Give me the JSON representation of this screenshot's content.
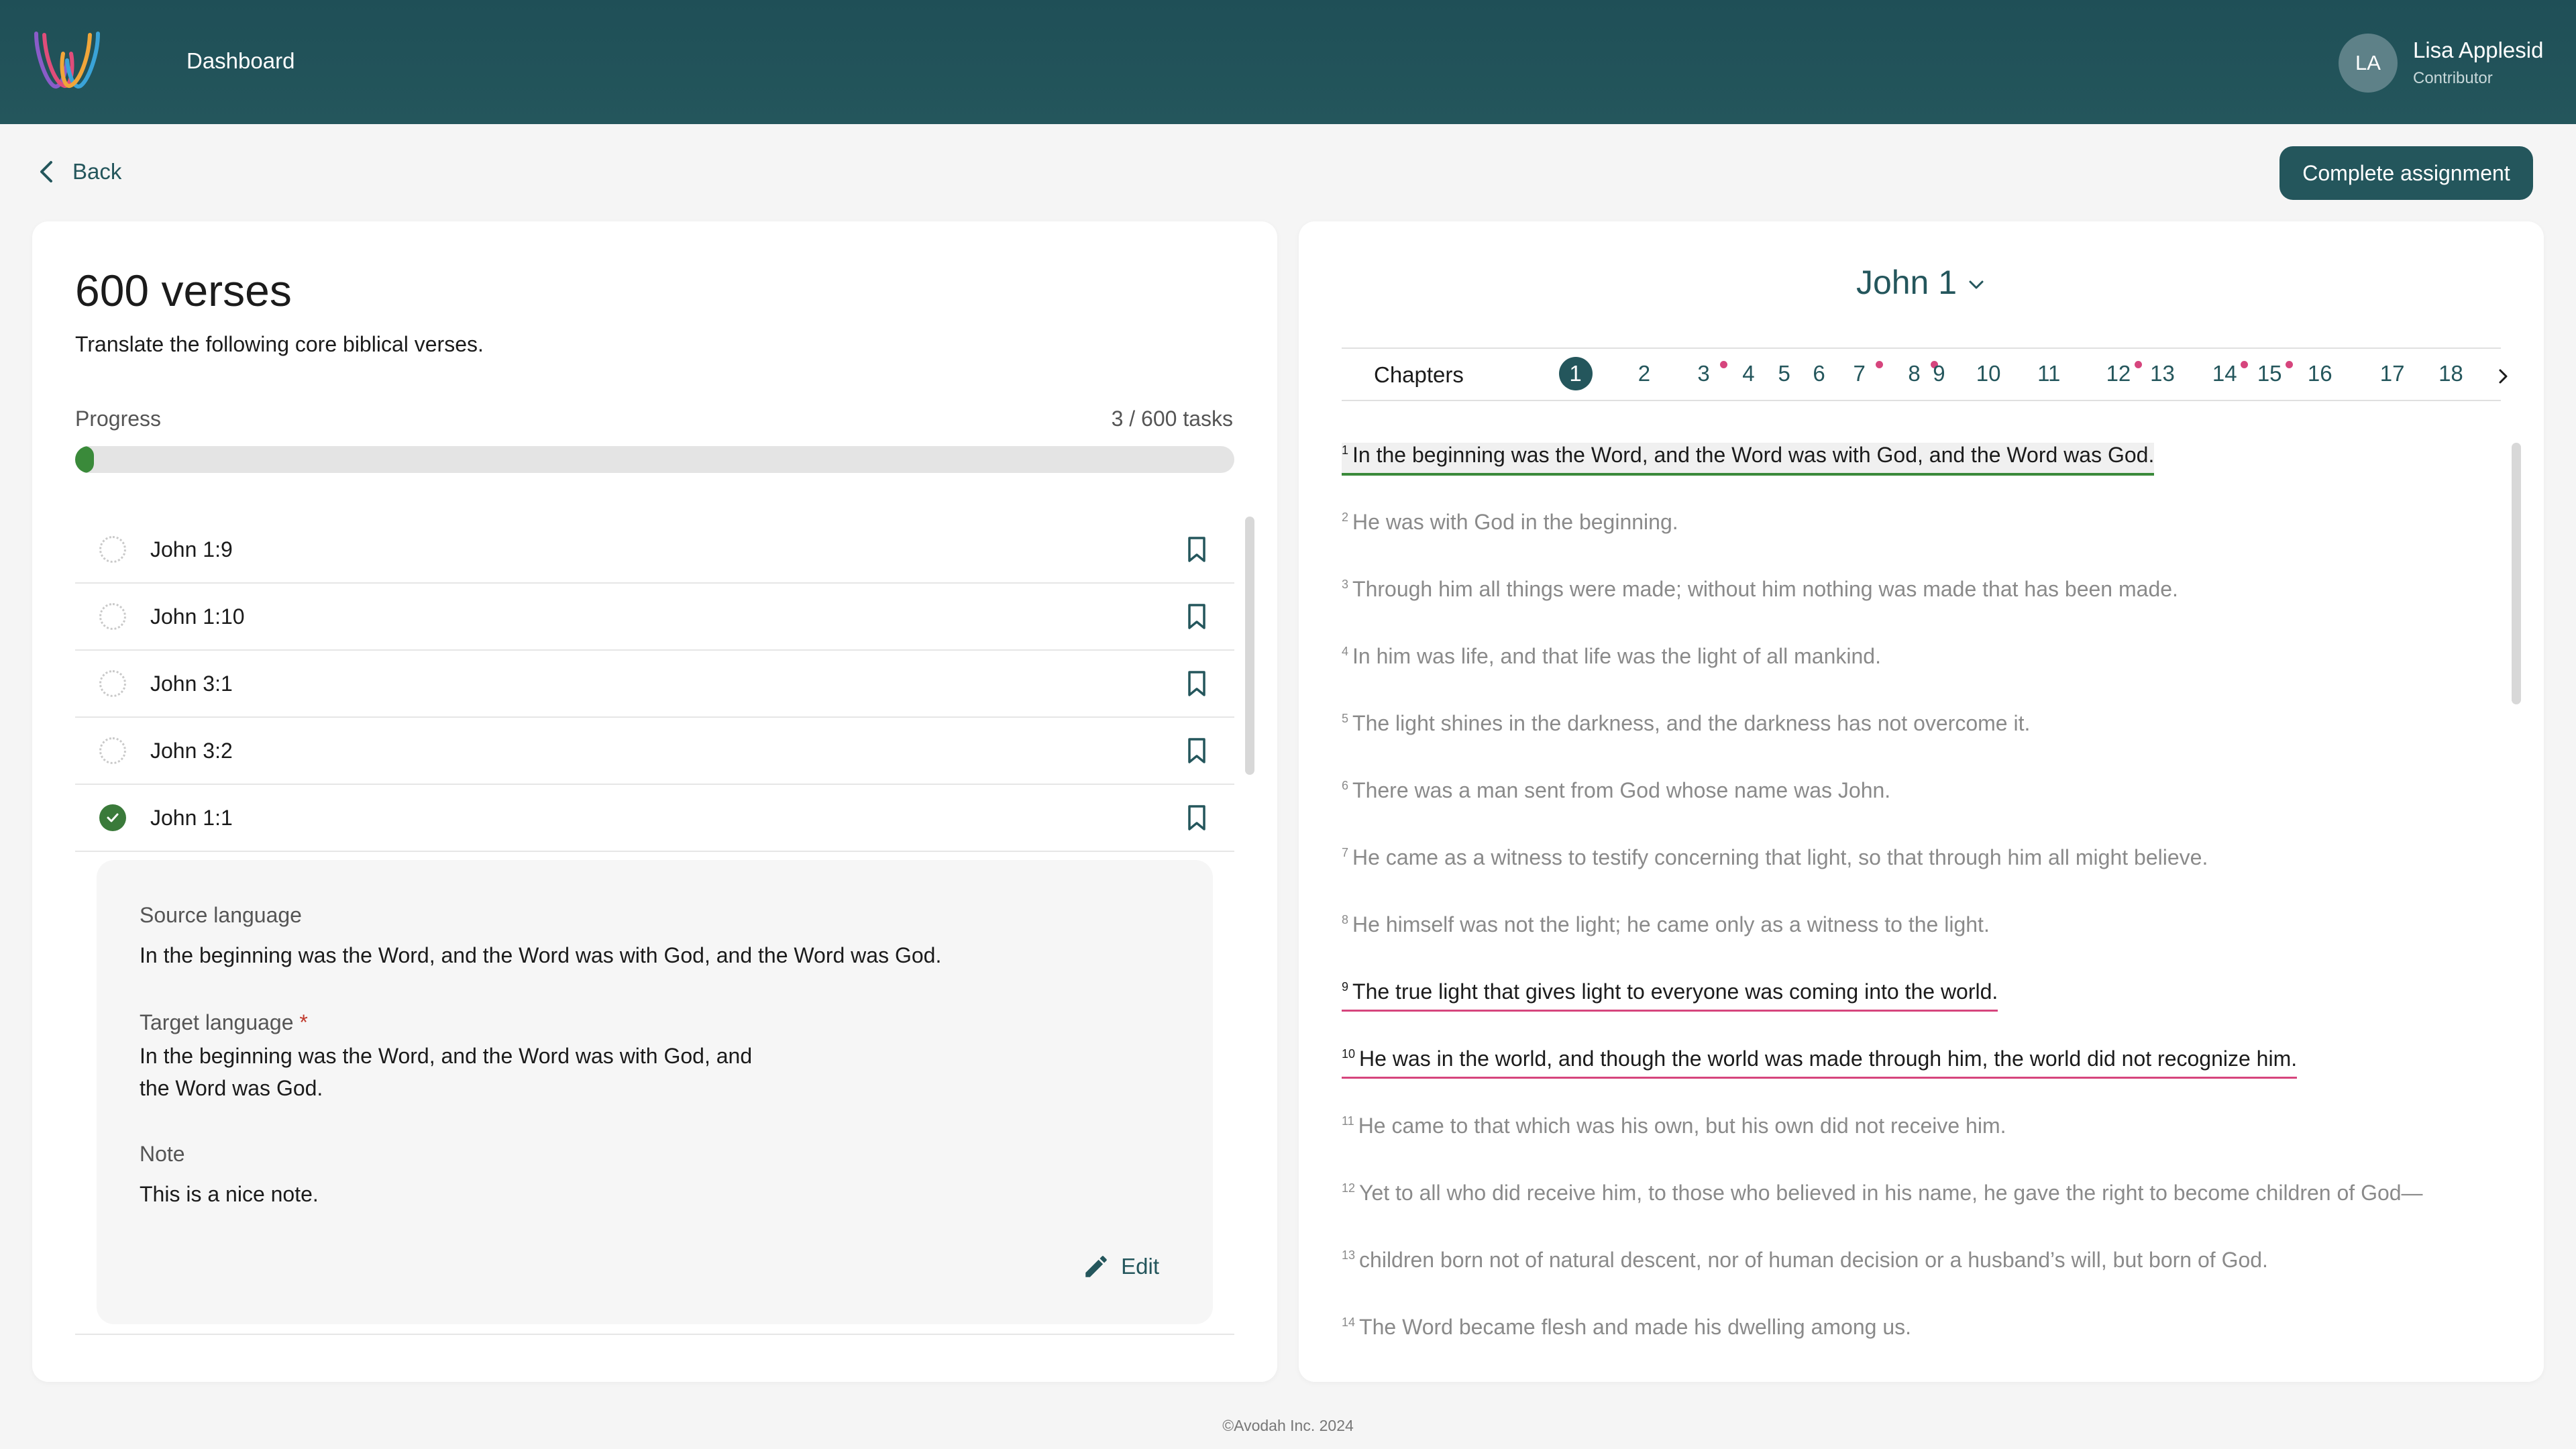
{
  "header": {
    "nav_label": "Dashboard",
    "user": {
      "initials": "LA",
      "name": "Lisa Applesid",
      "role": "Contributor"
    }
  },
  "toolbar": {
    "back_label": "Back",
    "complete_label": "Complete assignment"
  },
  "task": {
    "title": "600 verses",
    "subtitle": "Translate the following core biblical verses.",
    "progress_label": "Progress",
    "progress_text": "3 / 600 tasks",
    "progress_fraction": 0.005
  },
  "verse_list": [
    {
      "ref": "John 1:9",
      "done": false
    },
    {
      "ref": "John 1:10",
      "done": false
    },
    {
      "ref": "John 3:1",
      "done": false
    },
    {
      "ref": "John 3:2",
      "done": false
    },
    {
      "ref": "John 1:1",
      "done": true
    }
  ],
  "detail": {
    "source_label": "Source language",
    "source_text": "In the beginning was the Word, and the Word was with God, and the Word was God.",
    "target_label": "Target language",
    "required_mark": "*",
    "target_line1": "In the beginning was the Word, and the Word was with God, and",
    "target_line2": "the Word was God.",
    "note_label": "Note",
    "note_text": "This is a nice note.",
    "edit_label": "Edit"
  },
  "reader": {
    "book_label": "John 1",
    "chapters_label": "Chapters",
    "chapters": [
      {
        "n": "1",
        "active": true,
        "dot": false
      },
      {
        "n": "2",
        "active": false,
        "dot": false
      },
      {
        "n": "3",
        "active": false,
        "dot": true
      },
      {
        "n": "4",
        "active": false,
        "dot": false
      },
      {
        "n": "5",
        "active": false,
        "dot": false
      },
      {
        "n": "6",
        "active": false,
        "dot": false
      },
      {
        "n": "7",
        "active": false,
        "dot": true
      },
      {
        "n": "8",
        "active": false,
        "dot": true
      },
      {
        "n": "9",
        "active": false,
        "dot": false
      },
      {
        "n": "10",
        "active": false,
        "dot": false
      },
      {
        "n": "11",
        "active": false,
        "dot": false
      },
      {
        "n": "12",
        "active": false,
        "dot": true
      },
      {
        "n": "13",
        "active": false,
        "dot": false
      },
      {
        "n": "14",
        "active": false,
        "dot": true
      },
      {
        "n": "15",
        "active": false,
        "dot": true
      },
      {
        "n": "16",
        "active": false,
        "dot": false
      },
      {
        "n": "17",
        "active": false,
        "dot": false
      },
      {
        "n": "18",
        "active": false,
        "dot": false
      }
    ],
    "verses": [
      {
        "num": "1",
        "text": "In the beginning was the Word, and the Word was with God, and the Word was God.",
        "state": "current"
      },
      {
        "num": "2",
        "text": "He was with God in the beginning.",
        "state": "normal"
      },
      {
        "num": "3",
        "text": "Through him all things were made; without him nothing was made that has been made.",
        "state": "normal"
      },
      {
        "num": "4",
        "text": "In him was life, and that life was the light of all mankind.",
        "state": "normal"
      },
      {
        "num": "5",
        "text": "The light shines in the darkness, and the darkness has not overcome it.",
        "state": "normal"
      },
      {
        "num": "6",
        "text": "There was a man sent from God whose name was John.",
        "state": "normal"
      },
      {
        "num": "7",
        "text": "He came as a witness to testify concerning that light, so that through him all might believe.",
        "state": "normal"
      },
      {
        "num": "8",
        "text": "He himself was not the light; he came only as a witness to the light.",
        "state": "normal"
      },
      {
        "num": "9",
        "text": "The true light that gives light to everyone was coming into the world.",
        "state": "flagged"
      },
      {
        "num": "10",
        "text": "He was in the world, and though the world was made through him, the world did not recognize him.",
        "state": "flagged"
      },
      {
        "num": "11",
        "text": "He came to that which was his own, but his own did not receive him.",
        "state": "normal"
      },
      {
        "num": "12",
        "text": "Yet to all who did receive him, to those who believed in his name, he gave the right to become children of God—",
        "state": "normal"
      },
      {
        "num": "13",
        "text": "children born not of natural descent, nor of human decision or a husband’s will, but born of God.",
        "state": "normal"
      },
      {
        "num": "14",
        "text": "The Word became flesh and made his dwelling among us.",
        "state": "normal"
      }
    ]
  },
  "footer": {
    "text": "©Avodah Inc. 2024"
  },
  "colors": {
    "brand": "#24565c",
    "success": "#3a8a3a",
    "flag": "#d6457d"
  }
}
